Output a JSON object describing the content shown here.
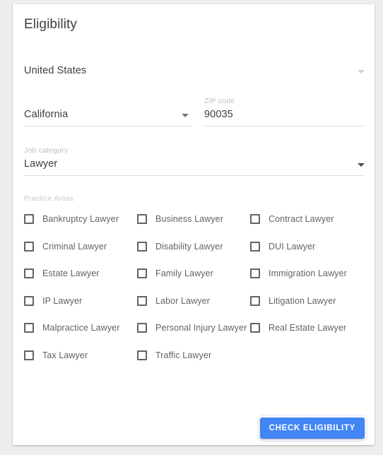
{
  "card": {
    "title": "Eligibility"
  },
  "form": {
    "country": {
      "value": "United States",
      "caret": "chevron-down-icon"
    },
    "state": {
      "value": "California",
      "caret": "chevron-down-icon"
    },
    "zip": {
      "label": "ZIP code",
      "value": "90035",
      "placeholder": "ZIP code"
    },
    "job_category": {
      "label": "Job category",
      "value": "Lawyer",
      "caret": "chevron-down-icon"
    }
  },
  "practice_areas": {
    "label": "Practice Areas",
    "items": [
      {
        "label": "Bankruptcy Lawyer",
        "checked": false
      },
      {
        "label": "Business Lawyer",
        "checked": false
      },
      {
        "label": "Contract Lawyer",
        "checked": false
      },
      {
        "label": "Criminal Lawyer",
        "checked": false
      },
      {
        "label": "Disability Lawyer",
        "checked": false
      },
      {
        "label": "DUI Lawyer",
        "checked": false
      },
      {
        "label": "Estate Lawyer",
        "checked": false
      },
      {
        "label": "Family Lawyer",
        "checked": false
      },
      {
        "label": "Immigration Lawyer",
        "checked": false
      },
      {
        "label": "IP Lawyer",
        "checked": false
      },
      {
        "label": "Labor Lawyer",
        "checked": false
      },
      {
        "label": "Litigation Lawyer",
        "checked": false
      },
      {
        "label": "Malpractice Lawyer",
        "checked": false
      },
      {
        "label": "Personal Injury Lawyer",
        "checked": false
      },
      {
        "label": "Real Estate Lawyer",
        "checked": false
      },
      {
        "label": "Tax Lawyer",
        "checked": false
      },
      {
        "label": "Traffic Lawyer",
        "checked": false
      }
    ]
  },
  "actions": {
    "submit_label": "CHECK ELIGIBILITY"
  },
  "colors": {
    "accent": "#4285f4",
    "page_background": "#eeeeee",
    "card_background": "#ffffff",
    "text_primary": "#3c4043",
    "text_secondary": "#5f6368",
    "label_muted": "#bdbdbd",
    "underline": "#dadce0"
  }
}
